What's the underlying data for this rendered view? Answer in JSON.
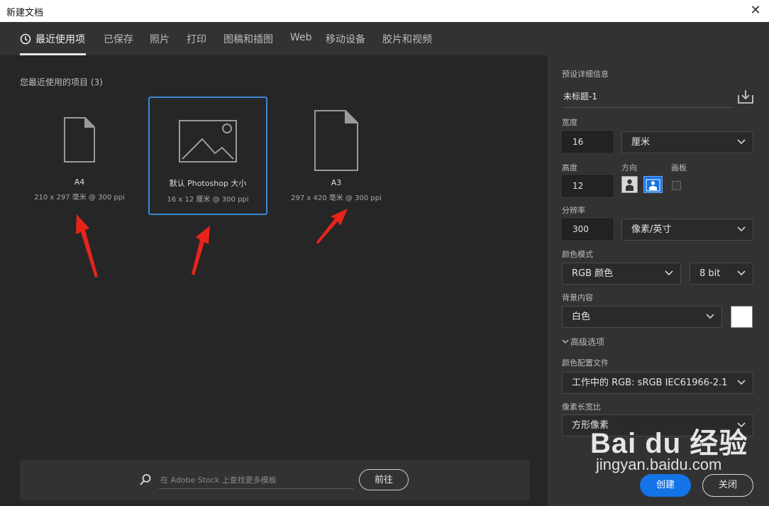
{
  "window": {
    "title": "新建文档"
  },
  "tabs": [
    {
      "label": "最近使用项"
    },
    {
      "label": "已保存"
    },
    {
      "label": "照片"
    },
    {
      "label": "打印"
    },
    {
      "label": "图稿和插图"
    },
    {
      "label": "Web"
    },
    {
      "label": "移动设备"
    },
    {
      "label": "胶片和视频"
    }
  ],
  "recent": {
    "title": "您最近使用的项目",
    "count": "(3)",
    "items": [
      {
        "name": "A4",
        "size": "210 x 297 毫米 @ 300 ppi",
        "icon": "document-icon"
      },
      {
        "name": "默认 Photoshop 大小",
        "size": "16 x 12 厘米 @ 300 ppi",
        "icon": "image-icon"
      },
      {
        "name": "A3",
        "size": "297 x 420 毫米 @ 300 ppi",
        "icon": "document-icon"
      }
    ]
  },
  "search": {
    "placeholder": "在 Adobe Stock 上查找更多模板",
    "go_label": "前往"
  },
  "details": {
    "section_label": "预设详细信息",
    "preset_name": "未标题-1",
    "width_label": "宽度",
    "width_value": "16",
    "width_unit": "厘米",
    "height_label": "高度",
    "height_value": "12",
    "orientation_label": "方向",
    "artboard_label": "画板",
    "resolution_label": "分辨率",
    "resolution_value": "300",
    "resolution_unit": "像素/英寸",
    "color_mode_label": "颜色模式",
    "color_mode": "RGB 颜色",
    "bit_depth": "8 bit",
    "background_label": "背景内容",
    "background": "白色",
    "advanced_label": "高级选项",
    "color_profile_label": "颜色配置文件",
    "color_profile": "工作中的 RGB: sRGB IEC61966-2.1",
    "pixel_aspect_label": "像素长宽比",
    "pixel_aspect": "方形像素",
    "create_label": "创建",
    "close_label": "关闭"
  },
  "watermark": {
    "logo": "Bai du 经验",
    "url": "jingyan.baidu.com"
  },
  "colors": {
    "accent": "#1473e6",
    "selection": "#3b86d8",
    "annotation_arrow": "#e8231c"
  }
}
